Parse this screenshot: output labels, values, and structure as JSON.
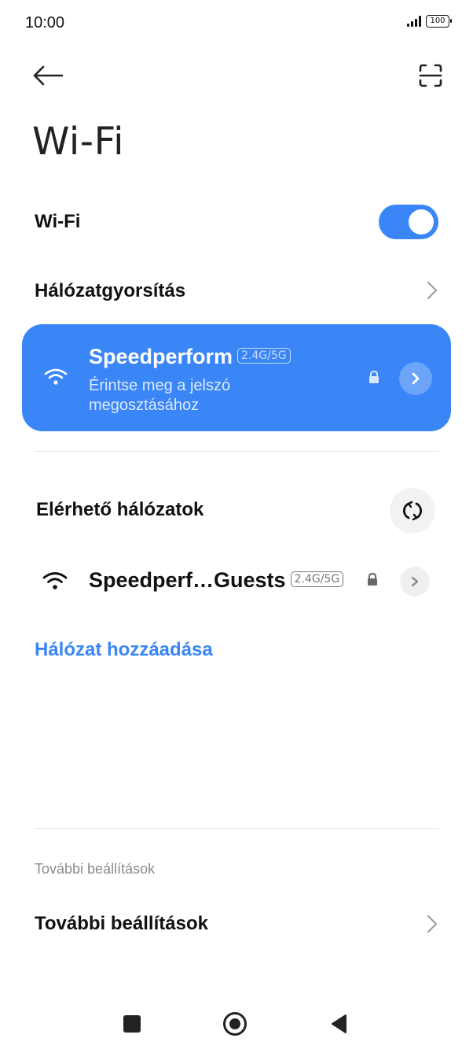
{
  "status_bar": {
    "time": "10:00",
    "battery": "100",
    "icons": [
      "signal-icon",
      "battery-icon"
    ]
  },
  "header": {
    "back_icon": "arrow-left-icon",
    "scan_icon": "scan-icon",
    "title": "Wi-Fi"
  },
  "wifi_toggle": {
    "label": "Wi-Fi",
    "state": "on",
    "color": "#3a86f7"
  },
  "acceleration": {
    "label": "Hálózatgyorsítás"
  },
  "connected_network": {
    "name": "Speedperform",
    "band": "2.4G/5G",
    "subtitle": "Érintse meg a jelszó megosztásához",
    "secured": true,
    "background_color": "#3a86f7"
  },
  "available": {
    "label": "Elérhető hálózatok",
    "refresh_icon": "refresh-icon",
    "networks": [
      {
        "name": "Speedperf…Guests",
        "band": "2.4G/5G",
        "secured": true
      }
    ]
  },
  "add_network": {
    "label": "Hálózat hozzáadása",
    "color": "#3a86f7"
  },
  "more_settings": {
    "section_caption": "További beállítások",
    "label": "További beállítások"
  },
  "nav_bar": {
    "icons": [
      "recents-square-icon",
      "home-circle-icon",
      "back-triangle-icon"
    ]
  }
}
